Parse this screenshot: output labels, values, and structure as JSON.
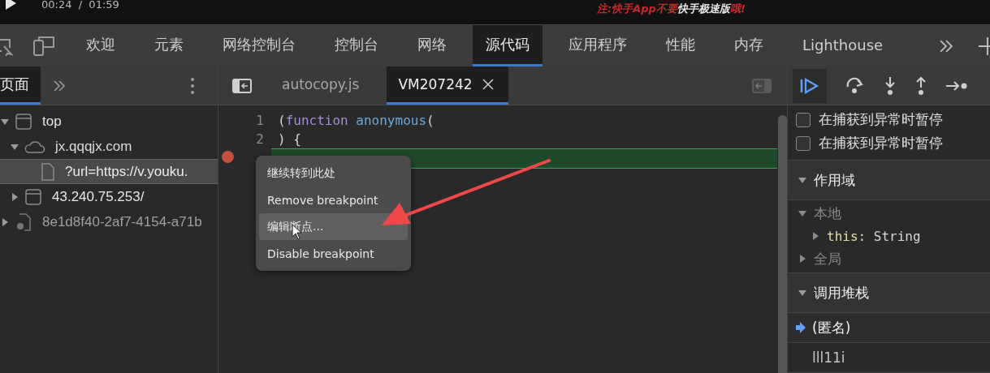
{
  "video_bar": {
    "time": "00:24  /  01:59",
    "caption": [
      {
        "text": "注:快手App不要",
        "color": "#c8282a"
      },
      {
        "text": "快手极速版",
        "color": "#e6e6e6"
      },
      {
        "text": "哦!",
        "color": "#c8282a"
      }
    ]
  },
  "main_tabs": [
    {
      "label": "欢迎",
      "selected": false
    },
    {
      "label": "元素",
      "selected": false
    },
    {
      "label": "网络控制台",
      "selected": false
    },
    {
      "label": "控制台",
      "selected": false
    },
    {
      "label": "网络",
      "selected": false
    },
    {
      "label": "源代码",
      "selected": true
    },
    {
      "label": "应用程序",
      "selected": false
    },
    {
      "label": "性能",
      "selected": false
    },
    {
      "label": "内存",
      "selected": false
    },
    {
      "label": "Lighthouse",
      "selected": false
    }
  ],
  "navigator": {
    "tabs": [
      {
        "label": "页面",
        "selected": true
      }
    ],
    "tree": [
      {
        "label": "top",
        "kind": "frame",
        "expanded": true,
        "selected": false,
        "children": [
          {
            "label": "jx.qqqjx.com",
            "kind": "domain",
            "expanded": true,
            "selected": false,
            "children": [
              {
                "label": "?url=https://v.youku.",
                "kind": "file",
                "selected": true
              }
            ]
          },
          {
            "label": "43.240.75.253/",
            "kind": "frame",
            "expanded": false,
            "selected": false
          }
        ]
      },
      {
        "label": "8e1d8f40-2af7-4154-a71b",
        "kind": "worker",
        "expanded": false,
        "selected": false
      }
    ]
  },
  "editor": {
    "tabs": [
      {
        "label": "autocopy.js",
        "selected": false
      },
      {
        "label": "VM207242",
        "selected": true
      }
    ],
    "lines": [
      {
        "number": "1",
        "tokens": [
          {
            "text": "(",
            "kind": "punct"
          },
          {
            "text": "function",
            "kind": "keyword"
          },
          {
            "text": " anonymous",
            "kind": "name"
          },
          {
            "text": "(",
            "kind": "punct"
          }
        ]
      },
      {
        "number": "2",
        "tokens": [
          {
            "text": ") {",
            "kind": "punct"
          }
        ]
      }
    ],
    "current_line": {
      "breakpoint": true
    },
    "context_menu": [
      {
        "label": "继续转到此处",
        "selected": false
      },
      {
        "label": "Remove breakpoint",
        "selected": false
      },
      {
        "label": "编辑断点...",
        "selected": true
      },
      {
        "label": "Disable breakpoint",
        "selected": false
      }
    ]
  },
  "debugger": {
    "pause_options": [
      {
        "label": "在捕获到异常时暂停",
        "checked": false
      },
      {
        "label": "在捕获到异常时暂停",
        "checked": false
      }
    ],
    "scope": {
      "title": "作用域",
      "expanded": true,
      "items": [
        {
          "label": "本地",
          "expanded": true,
          "children": [
            {
              "name": "this:",
              "value": "String",
              "expanded": false
            }
          ]
        },
        {
          "label": "全局",
          "expanded": false
        }
      ]
    },
    "call_stack": {
      "title": "调用堆栈",
      "expanded": true,
      "frames": [
        {
          "label": "(匿名)",
          "selected": true
        },
        {
          "label": "lll11i",
          "selected": false
        }
      ]
    }
  }
}
